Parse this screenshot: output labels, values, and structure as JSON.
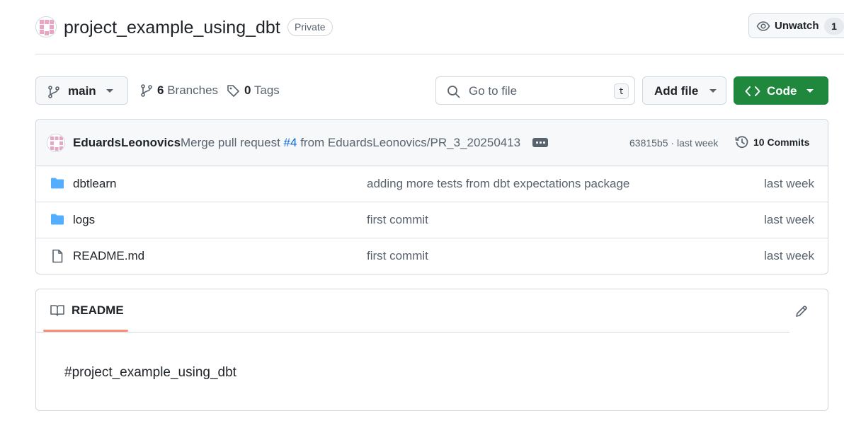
{
  "repo": {
    "name": "project_example_using_dbt",
    "visibility": "Private",
    "watch_label": "Unwatch",
    "watch_count": "1"
  },
  "toolbar": {
    "branch": "main",
    "branches_count": "6",
    "branches_label": "Branches",
    "tags_count": "0",
    "tags_label": "Tags",
    "search_placeholder": "Go to file",
    "search_shortcut": "t",
    "add_file_label": "Add file",
    "code_label": "Code"
  },
  "latest_commit": {
    "author": "EduardsLeonovics",
    "message_prefix": "Merge pull request",
    "pr_ref": "#4",
    "message_suffix": "from EduardsLeonovics/PR_3_20250413",
    "sha": "63815b5",
    "time": "last week",
    "commits_label": "10 Commits"
  },
  "files": [
    {
      "name": "dbtlearn",
      "type": "folder",
      "message": "adding more tests from dbt expectations package",
      "time": "last week"
    },
    {
      "name": "logs",
      "type": "folder",
      "message": "first commit",
      "time": "last week"
    },
    {
      "name": "README.md",
      "type": "file",
      "message": "first commit",
      "time": "last week"
    }
  ],
  "readme": {
    "tab_label": "README",
    "content": "#project_example_using_dbt"
  },
  "colors": {
    "accent_green": "#1f883d",
    "link_blue": "#0969da",
    "folder_blue": "#54aeff",
    "tab_underline": "#fd8c73",
    "avatar_pink": "#e8a6c5"
  }
}
